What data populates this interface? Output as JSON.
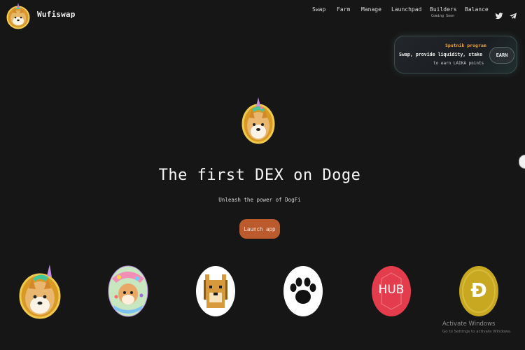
{
  "header": {
    "brand": "Wufiswap",
    "nav": [
      {
        "label": "Swap"
      },
      {
        "label": "Farm"
      },
      {
        "label": "Manage"
      },
      {
        "label": "Launchpad"
      },
      {
        "label": "Builders",
        "sublabel": "Coming Soon"
      },
      {
        "label": "Balance"
      }
    ],
    "social": [
      "twitter-icon",
      "telegram-icon"
    ]
  },
  "promo": {
    "title": "Sputnik program",
    "line1": "Swap, provide liquidity, stake",
    "line2": "to earn LAIKA points",
    "button": "EARN"
  },
  "hero": {
    "title": "The first DEX on Doge",
    "subtitle": "Unleash the power of DogFi",
    "cta": "Launch app"
  },
  "partners": [
    {
      "name": "wufi-unicorn-doge-logo"
    },
    {
      "name": "colorful-doge-logo"
    },
    {
      "name": "pixel-doge-logo"
    },
    {
      "name": "paw-print-logo"
    },
    {
      "name": "hub-logo",
      "text": "HUB"
    },
    {
      "name": "dogecoin-logo",
      "text": "Ð"
    }
  ],
  "watermark": {
    "line1": "Activate Windows",
    "line2": "Go to Settings to activate Windows."
  },
  "colors": {
    "background": "#161616",
    "accent": "#bb5a2c",
    "promo_title": "#e7a24a"
  }
}
